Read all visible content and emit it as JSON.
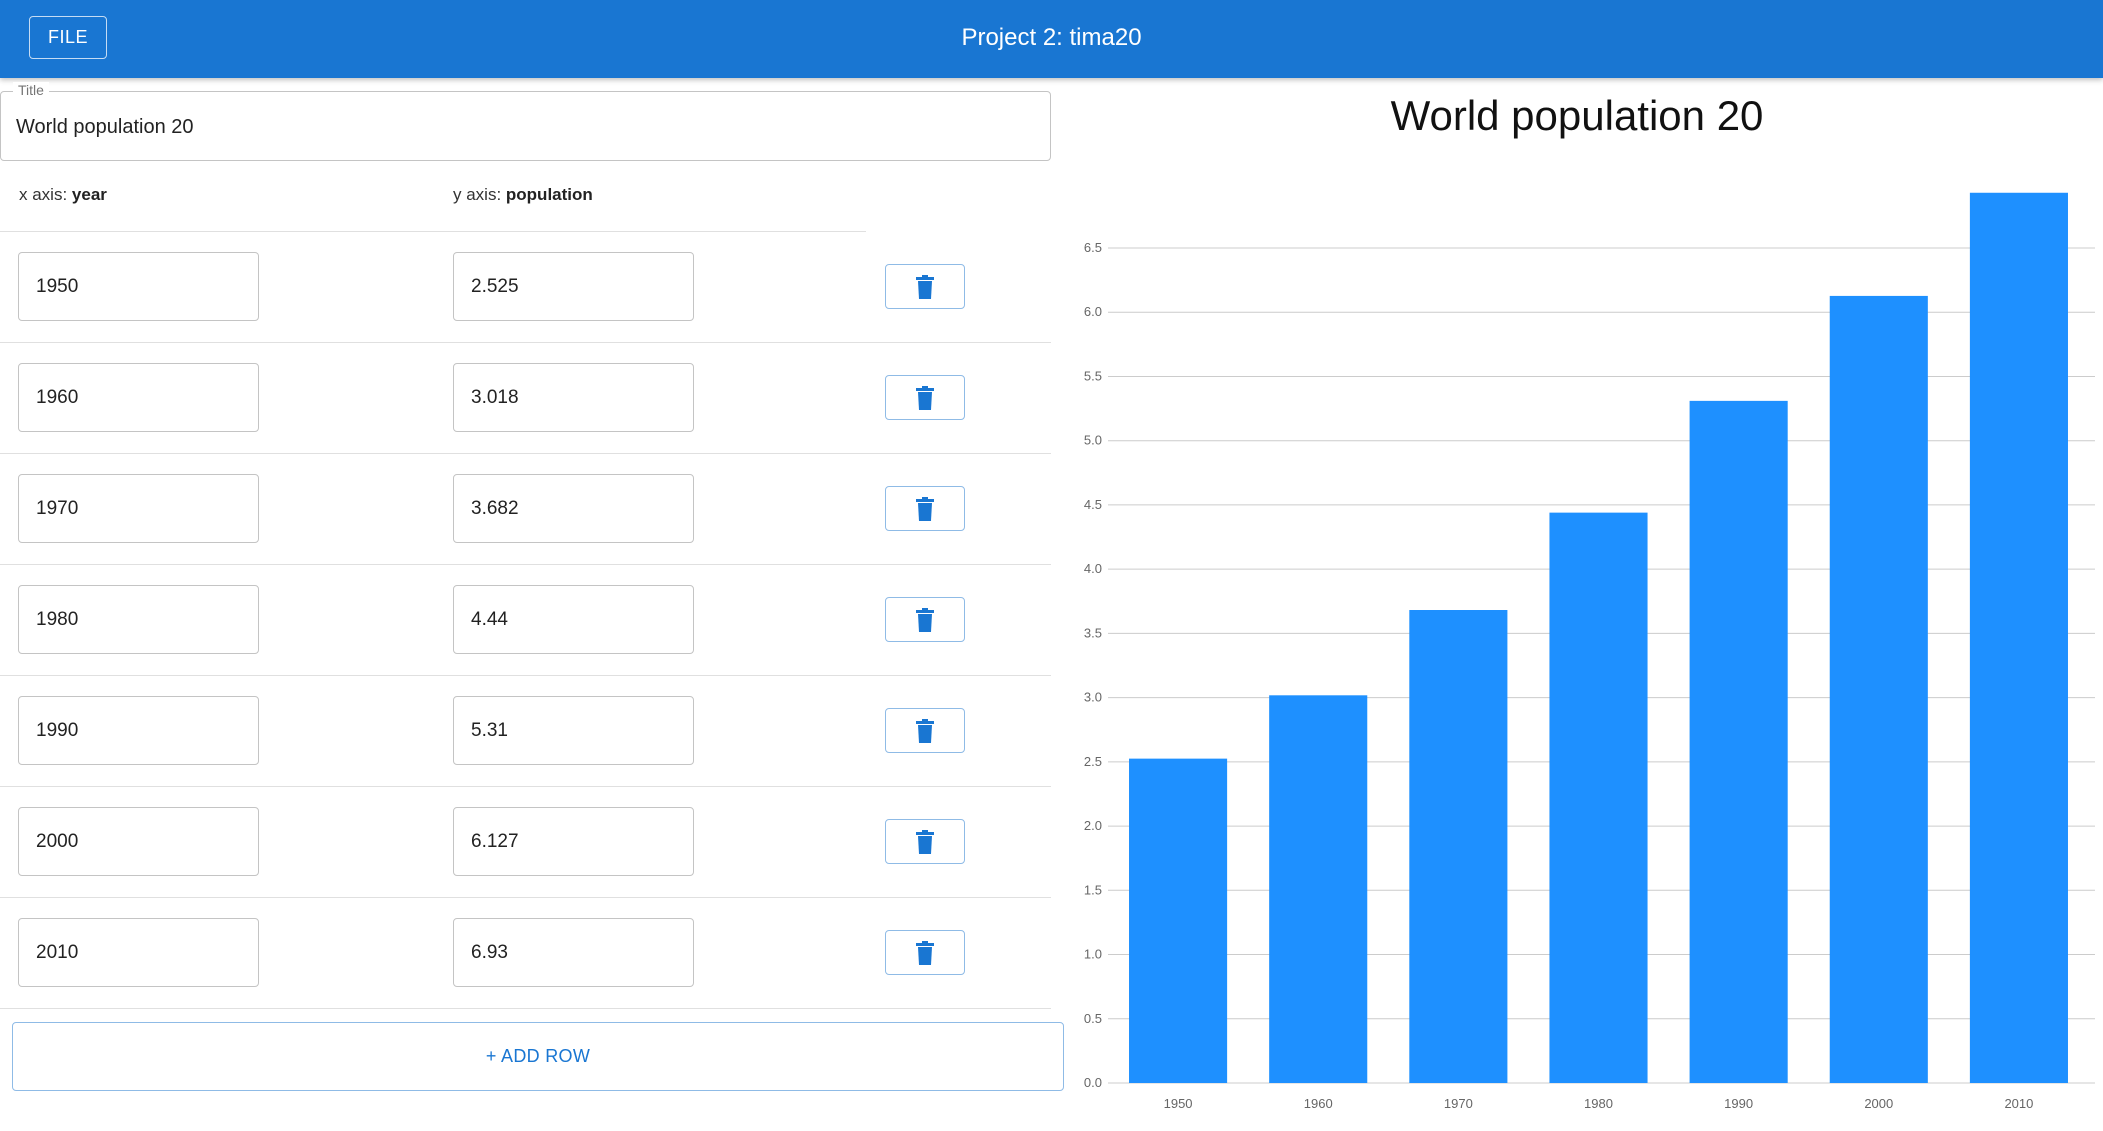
{
  "appbar": {
    "file_label": "FILE",
    "title": "Project 2: tima20"
  },
  "editor": {
    "title_legend": "Title",
    "title_value": "World population 20",
    "x_axis_prefix": "x axis: ",
    "x_axis_name": "year",
    "y_axis_prefix": "y axis: ",
    "y_axis_name": "population",
    "rows": [
      {
        "x": "1950",
        "y": "2.525"
      },
      {
        "x": "1960",
        "y": "3.018"
      },
      {
        "x": "1970",
        "y": "3.682"
      },
      {
        "x": "1980",
        "y": "4.44"
      },
      {
        "x": "1990",
        "y": "5.31"
      },
      {
        "x": "2000",
        "y": "6.127"
      },
      {
        "x": "2010",
        "y": "6.93"
      }
    ],
    "delete_icon": "trash-icon",
    "add_row_label": "+ ADD ROW"
  },
  "colors": {
    "appbar": "#1976d2",
    "bar": "#1e90ff",
    "accent": "#1976d2"
  },
  "chart_data": {
    "type": "bar",
    "title": "World population 20",
    "categories": [
      "1950",
      "1960",
      "1970",
      "1980",
      "1990",
      "2000",
      "2010"
    ],
    "values": [
      2.525,
      3.018,
      3.682,
      4.44,
      5.31,
      6.127,
      6.93
    ],
    "xlabel": "",
    "ylabel": "",
    "ylim": [
      0,
      6.5
    ],
    "y_ticks": [
      "0.0",
      "0.5",
      "1.0",
      "1.5",
      "2.0",
      "2.5",
      "3.0",
      "3.5",
      "4.0",
      "4.5",
      "5.0",
      "5.5",
      "6.0",
      "6.5"
    ],
    "grid": true,
    "legend": "none"
  }
}
